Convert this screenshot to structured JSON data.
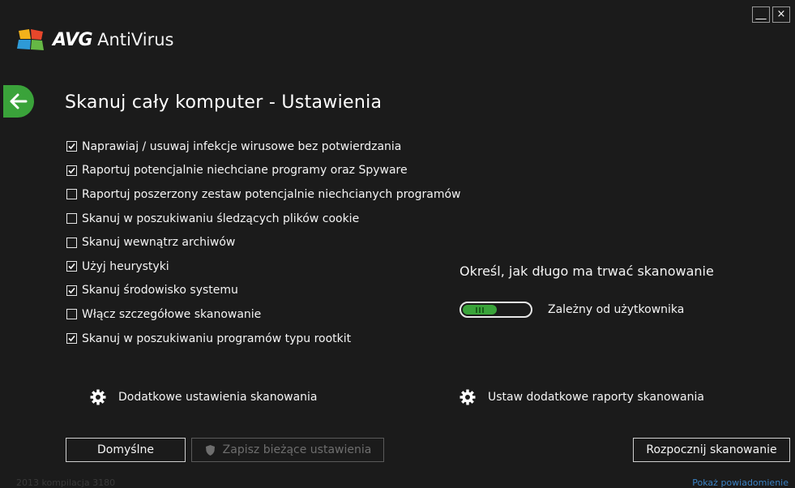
{
  "window": {
    "minimize_label": "__",
    "close_label": "×"
  },
  "app": {
    "brand": "AVG",
    "product": "AntiVirus"
  },
  "page": {
    "title": "Skanuj cały komputer - Ustawienia"
  },
  "options": [
    {
      "label": "Naprawiaj / usuwaj infekcje wirusowe bez potwierdzania",
      "checked": true
    },
    {
      "label": "Raportuj potencjalnie niechciane programy oraz Spyware",
      "checked": true
    },
    {
      "label": "Raportuj poszerzony zestaw potencjalnie niechcianych programów",
      "checked": false
    },
    {
      "label": "Skanuj w poszukiwaniu śledzących plików cookie",
      "checked": false
    },
    {
      "label": "Skanuj wewnątrz archiwów",
      "checked": false
    },
    {
      "label": "Użyj heurystyki",
      "checked": true
    },
    {
      "label": "Skanuj środowisko systemu",
      "checked": true
    },
    {
      "label": "Włącz szczegółowe skanowanie",
      "checked": false
    },
    {
      "label": "Skanuj w poszukiwaniu programów typu rootkit",
      "checked": true
    }
  ],
  "duration": {
    "heading": "Określ, jak długo ma trwać skanowanie",
    "value_label": "Zależny od użytkownika"
  },
  "links": {
    "additional_settings": "Dodatkowe ustawienia skanowania",
    "additional_reports": "Ustaw dodatkowe raporty skanowania"
  },
  "buttons": {
    "defaults": "Domyślne",
    "save_current": "Zapisz bieżące ustawienia",
    "start_scan": "Rozpocznij skanowanie"
  },
  "footer": {
    "build": "2013 kompilacja 3180",
    "show_notification": "Pokaż powiadomienie"
  },
  "colors": {
    "accent_green": "#3aa33a",
    "background": "#1b1b1b",
    "link_blue": "#3b82c4"
  }
}
